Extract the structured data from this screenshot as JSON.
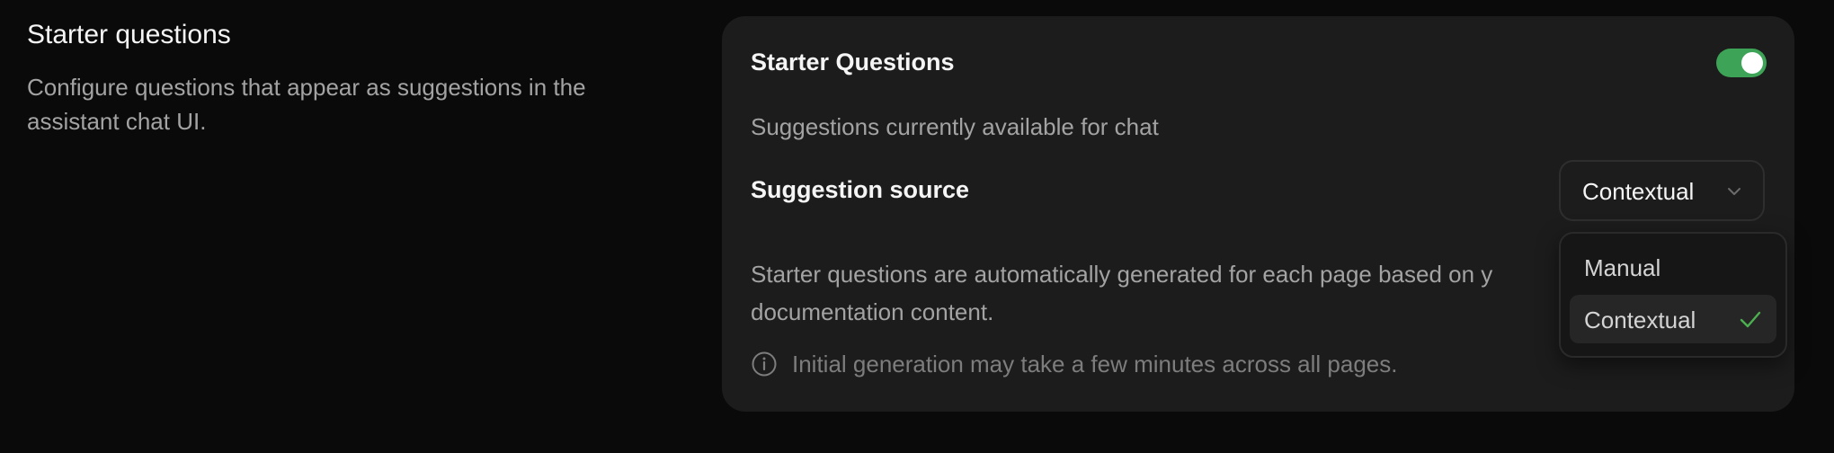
{
  "section": {
    "title": "Starter questions",
    "description": "Configure questions that appear as suggestions in the assistant chat UI."
  },
  "card": {
    "title": "Starter Questions",
    "toggle_on": true,
    "subtitle": "Suggestions currently available for chat",
    "source_label": "Suggestion source",
    "select_value": "Contextual",
    "body_text_line1": "Starter questions are automatically generated for each page based on y",
    "body_text_line2": "documentation content.",
    "info_text": "Initial generation may take a few minutes across all pages."
  },
  "dropdown": {
    "options": [
      {
        "label": "Manual",
        "selected": false
      },
      {
        "label": "Contextual",
        "selected": true
      }
    ]
  },
  "colors": {
    "accent_green": "#3da356",
    "check_green": "#4caf50",
    "card_bg": "#1c1c1c",
    "page_bg": "#0a0a0a"
  },
  "icons": {
    "toggle": "toggle-switch",
    "select_chevron": "chevron-down-icon",
    "info": "info-icon",
    "check": "check-icon"
  }
}
